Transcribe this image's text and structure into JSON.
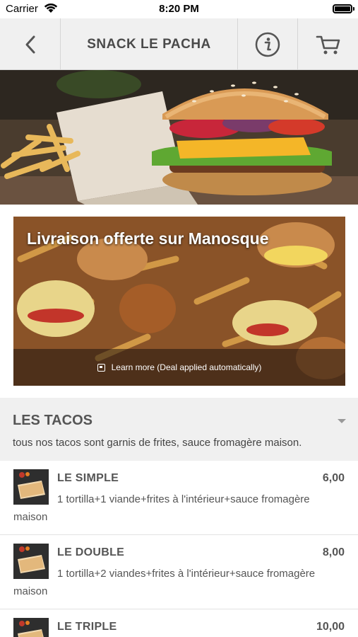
{
  "status_bar": {
    "carrier": "Carrier",
    "time": "8:20 PM"
  },
  "header": {
    "title": "SNACK LE PACHA",
    "back_icon": "chevron-left-icon",
    "info_icon": "info-icon",
    "cart_icon": "cart-icon"
  },
  "promo": {
    "title": "Livraison offerte sur Manosque",
    "link": "Learn more (Deal applied automatically)"
  },
  "category": {
    "title": "LES TACOS",
    "description": "tous nos tacos sont garnis de frites, sauce fromagère maison."
  },
  "items": [
    {
      "name": "LE SIMPLE",
      "price": "6,00",
      "description": "1 tortilla+1 viande+frites à l'intérieur+sauce fromagère maison"
    },
    {
      "name": "LE DOUBLE",
      "price": "8,00",
      "description": "1 tortilla+2 viandes+frites à l'intérieur+sauce fromagère maison"
    },
    {
      "name": "LE TRIPLE",
      "price": "10,00",
      "description": ""
    }
  ]
}
